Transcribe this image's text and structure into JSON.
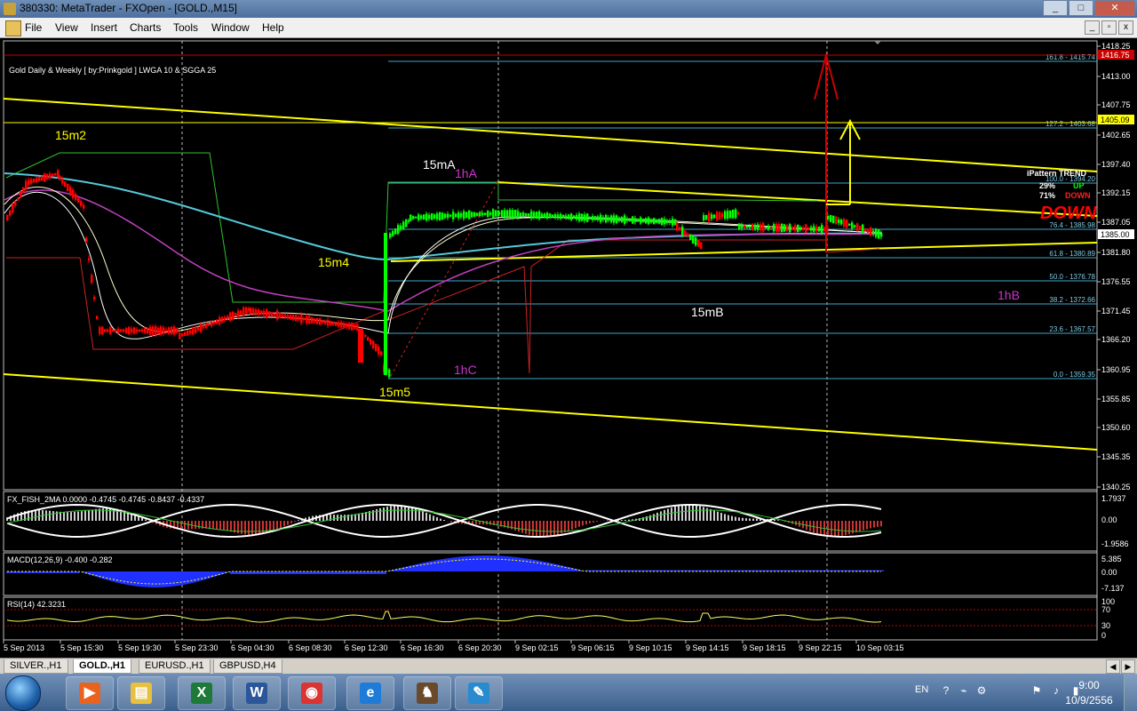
{
  "window": {
    "title": "380330: MetaTrader - FXOpen - [GOLD.,M15]",
    "controls": [
      "_",
      "□",
      "✕"
    ]
  },
  "menu": {
    "items": [
      "File",
      "View",
      "Insert",
      "Charts",
      "Tools",
      "Window",
      "Help"
    ]
  },
  "chart": {
    "header": "Gold Daily & Weekly [ by:Prinkgold ]  LWGA 10  &  SGGA 25",
    "price_ticks": [
      "1418.25",
      "1413.00",
      "1407.75",
      "1402.65",
      "1397.40",
      "1392.15",
      "1387.05",
      "1381.80",
      "1376.55",
      "1371.45",
      "1366.20",
      "1360.95",
      "1355.85",
      "1350.60",
      "1345.35",
      "1340.25"
    ],
    "price_tags": [
      {
        "label": "1416.75",
        "color": "#cc0000"
      },
      {
        "label": "1405.09",
        "color": "#ffff00"
      },
      {
        "label": "1385.00",
        "color": "#ffffff"
      }
    ],
    "fib_levels": [
      {
        "label": "161.8 - 1415.74"
      },
      {
        "label": "127.2 - 1403.68"
      },
      {
        "label": "100.0 - 1394.20"
      },
      {
        "label": "76.4 - 1385.98"
      },
      {
        "label": "61.8 - 1380.89"
      },
      {
        "label": "50.0 - 1376.78"
      },
      {
        "label": "38.2 - 1372.66"
      },
      {
        "label": "23.6 - 1367.57"
      },
      {
        "label": "0.0 - 1359.35"
      }
    ],
    "wave_labels": [
      {
        "text": "15m2",
        "color": "#ffff00"
      },
      {
        "text": "15mA",
        "color": "#ffffff"
      },
      {
        "text": "1hA",
        "color": "#cc33cc"
      },
      {
        "text": "15m4",
        "color": "#ffff00"
      },
      {
        "text": "15mB",
        "color": "#ffffff"
      },
      {
        "text": "1hB",
        "color": "#cc33cc"
      },
      {
        "text": "1hC",
        "color": "#cc33cc"
      },
      {
        "text": "15m5",
        "color": "#ffff00"
      }
    ],
    "trend_box": {
      "title": "iPattern TREND",
      "up_pct": "29%",
      "up_label": "UP",
      "down_pct": "71%",
      "down_label": "DOWN",
      "big_label": "DOWN"
    },
    "time_ticks": [
      "5 Sep 2013",
      "5 Sep 15:30",
      "5 Sep 19:30",
      "5 Sep 23:30",
      "6 Sep 04:30",
      "6 Sep 08:30",
      "6 Sep 12:30",
      "6 Sep 16:30",
      "6 Sep 20:30",
      "9 Sep 02:15",
      "9 Sep 06:15",
      "9 Sep 10:15",
      "9 Sep 14:15",
      "9 Sep 18:15",
      "9 Sep 22:15",
      "10 Sep 03:15"
    ],
    "colors": {
      "bull": "#00ff00",
      "bear": "#ff0000",
      "channel": "#ffff00",
      "fib": "#3fa7c8",
      "ma_cyan": "#56c8d8",
      "ma_magenta": "#c040c0"
    }
  },
  "indicators": {
    "fish": {
      "label": "FX_FISH_2MA 0.0000 -0.4745 -0.4745 -0.8437 -0.4337",
      "ticks": [
        "1.7937",
        "0.00",
        "-1.9586"
      ]
    },
    "macd": {
      "label": "MACD(12,26,9) -0.400 -0.282",
      "ticks": [
        "5.385",
        "0.00",
        "-7.137"
      ]
    },
    "rsi": {
      "label": "RSI(14) 42.3231",
      "ticks": [
        "100",
        "70",
        "30",
        "0"
      ]
    }
  },
  "tabs": [
    {
      "label": "SILVER.,H1",
      "active": false
    },
    {
      "label": "GOLD.,H1",
      "active": true
    },
    {
      "label": "EURUSD.,H1",
      "active": false
    },
    {
      "label": "GBPUSD,H4",
      "active": false
    }
  ],
  "taskbar": {
    "apps": [
      {
        "name": "media-player",
        "glyph": "▶",
        "color": "#e8641e"
      },
      {
        "name": "file-explorer",
        "glyph": "▤",
        "color": "#e8c040"
      },
      {
        "name": "excel",
        "glyph": "X",
        "color": "#1f7a3a"
      },
      {
        "name": "word",
        "glyph": "W",
        "color": "#2b579a"
      },
      {
        "name": "chrome",
        "glyph": "◉",
        "color": "#d33"
      },
      {
        "name": "internet-explorer",
        "glyph": "e",
        "color": "#1e7bd8"
      },
      {
        "name": "metatrader",
        "glyph": "♞",
        "color": "#6a4a2a"
      },
      {
        "name": "paint",
        "glyph": "✎",
        "color": "#2a8ad0"
      }
    ],
    "lang": "EN",
    "time": "9:00",
    "date": "10/9/2556"
  }
}
